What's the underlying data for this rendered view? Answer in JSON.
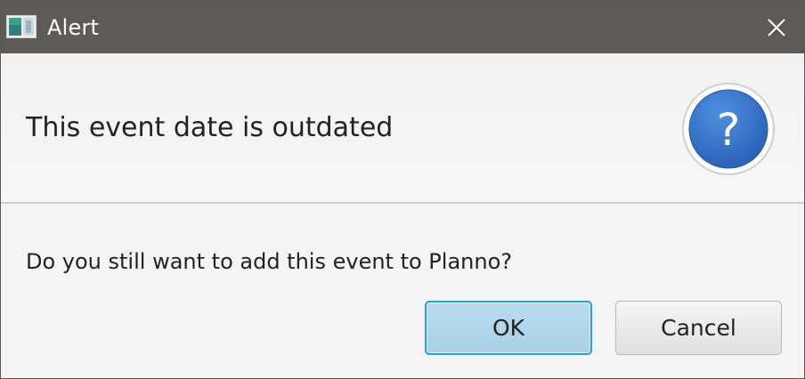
{
  "window": {
    "title": "Alert",
    "icon": "app-window-icon",
    "close_icon": "close-icon"
  },
  "header": {
    "text": "This event date is outdated",
    "icon": "question-icon",
    "icon_color": "#2f6fc6"
  },
  "content": {
    "text": "Do you still want to add this event to Planno?"
  },
  "buttons": {
    "ok_label": "OK",
    "cancel_label": "Cancel",
    "default_accent": "#2f9fd3"
  }
}
